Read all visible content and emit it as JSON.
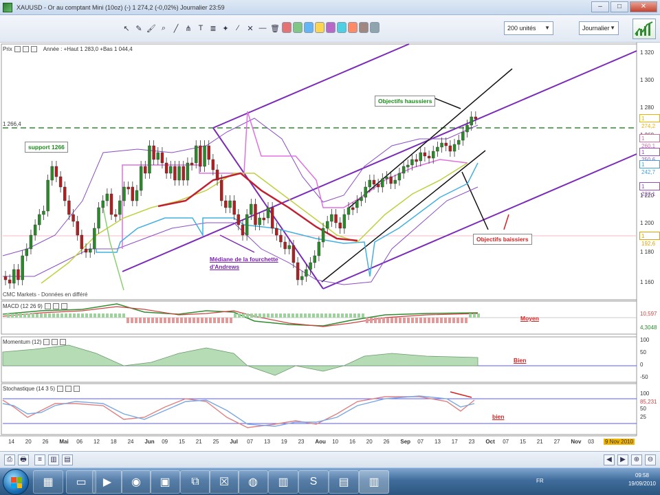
{
  "window": {
    "title": "XAUUSD - Or au comptant Mini (10oz) (-)   1 274,2 (-0,02%)   Journalier  23:59",
    "buttons": [
      "–",
      "□",
      "✕"
    ]
  },
  "toolbar": {
    "units_select": "200 unités",
    "period_select": "Journalier",
    "tool_icons": [
      "cursor",
      "pencil",
      "paint",
      "zoom",
      "line",
      "pitchfork",
      "text",
      "fibonacci",
      "magic",
      "wand",
      "cross",
      "horizontal-line",
      "trash"
    ],
    "swatches": [
      "#e57373",
      "#81c784",
      "#64b5f6",
      "#ffd54f",
      "#ba68c8",
      "#4dd0e1",
      "#ff8a65",
      "#a1887f",
      "#90a4ae"
    ]
  },
  "main_panel": {
    "label": "Prix",
    "info": "Année :  +Haut 1 283,0  +Bas 1 044,4",
    "level_label": "1 266,4",
    "footer_note": "CMC Markets - Données en différé"
  },
  "annotations": {
    "support": "support 1266",
    "objectifs_haussiers": "Objectifs haussiers",
    "objectifs_baissiers": "Objectifs baissiers",
    "mediane": "Médiane de la fourchette d'Andrews",
    "macd_rating": "Moyen",
    "momentum_rating": "Bien",
    "stoch_rating": "bien"
  },
  "price_axis": {
    "ticks": [
      "1 320",
      "1 300",
      "1 280",
      "1 260",
      "1 240",
      "1 220",
      "1 200",
      "1 180",
      "1 160"
    ],
    "tags": [
      {
        "text": "1 274,2",
        "color": "#f0b000"
      },
      {
        "text": "1 260,1",
        "color": "#d070a0"
      },
      {
        "text": "1 250,6",
        "color": "#9050c0"
      },
      {
        "text": "1 242,7",
        "color": "#40a0e0"
      },
      {
        "text": "1 227,1",
        "color": "#9050c0"
      },
      {
        "text": "1 192,6",
        "color": "#e0a000"
      }
    ]
  },
  "macd_panel": {
    "label": "MACD (12 26 9)",
    "tags": [
      "10,597",
      "4,3048"
    ]
  },
  "momentum_panel": {
    "label": "Momentum (12)",
    "ticks": [
      "100",
      "50",
      "0",
      "-50"
    ]
  },
  "stoch_panel": {
    "label": "Stochastique (14 3 5)",
    "ticks": [
      "100",
      "85,231",
      "50",
      "25"
    ]
  },
  "time_axis": {
    "labels": [
      "14",
      "20",
      "26",
      "Mai",
      "06",
      "12",
      "18",
      "24",
      "Jun",
      "09",
      "15",
      "21",
      "25",
      "Jul",
      "07",
      "13",
      "19",
      "23",
      "Aou",
      "10",
      "16",
      "20",
      "26",
      "Sep",
      "07",
      "13",
      "17",
      "23",
      "Oct",
      "07",
      "15",
      "21",
      "27",
      "Nov",
      "03",
      "9 Nov 2010"
    ]
  },
  "taskbar": {
    "lang": "FR",
    "time": "09:58",
    "date": "19/09/2010"
  }
}
